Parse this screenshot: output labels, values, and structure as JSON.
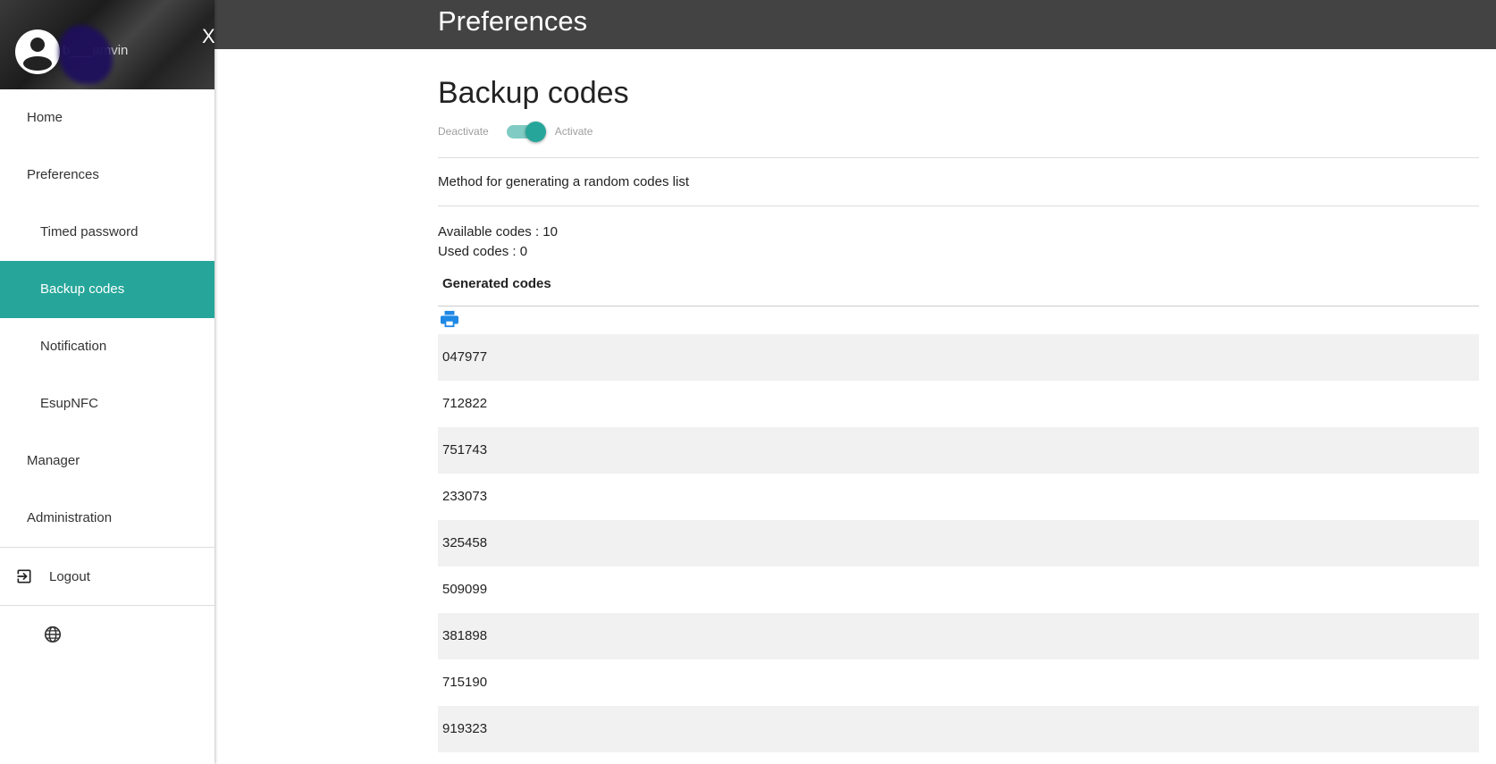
{
  "header": {
    "title": "Preferences"
  },
  "sidebar": {
    "user_name": "b___amvin",
    "close_label": "X",
    "items": [
      {
        "label": "Home",
        "sub": false,
        "active": false
      },
      {
        "label": "Preferences",
        "sub": false,
        "active": false
      },
      {
        "label": "Timed password",
        "sub": true,
        "active": false
      },
      {
        "label": "Backup codes",
        "sub": true,
        "active": true
      },
      {
        "label": "Notification",
        "sub": true,
        "active": false
      },
      {
        "label": "EsupNFC",
        "sub": true,
        "active": false
      },
      {
        "label": "Manager",
        "sub": false,
        "active": false
      },
      {
        "label": "Administration",
        "sub": false,
        "active": false
      }
    ],
    "logout_label": "Logout",
    "globe_icon": "language-icon",
    "accent": "#26a69a"
  },
  "main": {
    "title": "Backup codes",
    "toggle": {
      "off_label": "Deactivate",
      "on_label": "Activate",
      "state": "on"
    },
    "method_text": "Method for generating a random codes list",
    "available": "Available codes : 10",
    "used": "Used codes : 0",
    "generated_header": "Generated codes",
    "print_icon": "print-icon",
    "codes": [
      "047977",
      "712822",
      "751743",
      "233073",
      "325458",
      "509099",
      "381898",
      "715190",
      "919323"
    ]
  }
}
